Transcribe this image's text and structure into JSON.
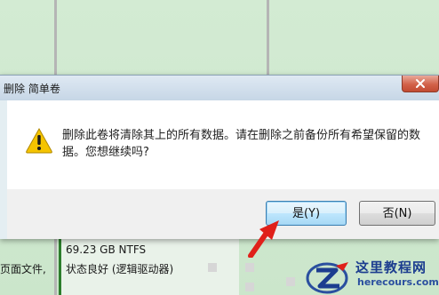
{
  "background": {
    "volume_size": "69.23 GB NTFS",
    "volume_status": "状态良好 (逻辑驱动器)",
    "left_partial_text": "页面文件,"
  },
  "dialog": {
    "title": "删除 简单卷",
    "message": "删除此卷将清除其上的所有数据。请在删除之前备份所有希望保留的数据。您想继续吗?",
    "yes_label": "是(Y)",
    "no_label": "否(N)"
  },
  "watermark": {
    "title": "这里教程网",
    "url": "herecours.com"
  },
  "colors": {
    "background_green": "#cfe8cf",
    "dialog_body": "#ffffff",
    "close_button": "#c24a32",
    "warning_yellow": "#f5c400",
    "arrow_red": "#e0201a",
    "watermark_blue": "#1c3d8f"
  }
}
